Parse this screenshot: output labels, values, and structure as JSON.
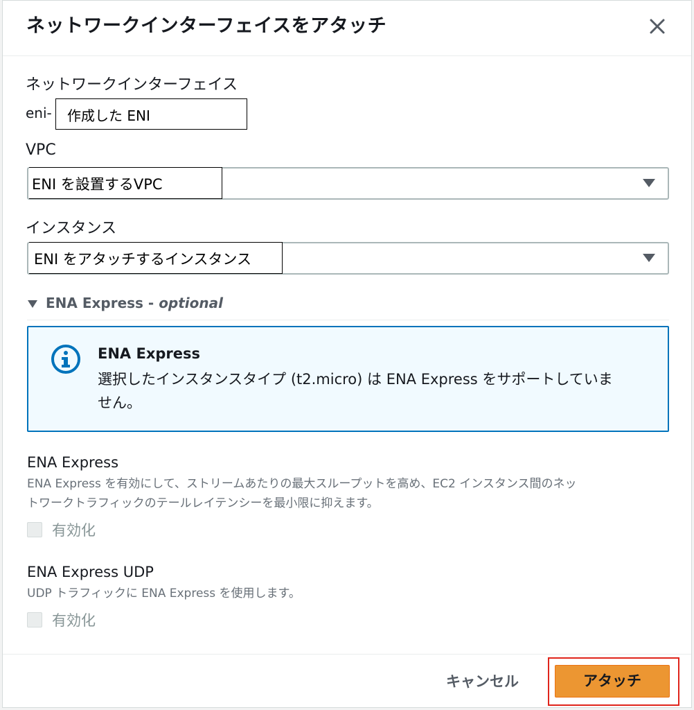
{
  "modal": {
    "title": "ネットワークインターフェイスをアタッチ"
  },
  "network_interface": {
    "label": "ネットワークインターフェイス",
    "prefix": "eni-",
    "value": "作成した ENI"
  },
  "vpc": {
    "label": "VPC",
    "value": "ENI を設置するVPC"
  },
  "instance": {
    "label": "インスタンス",
    "value": "ENI をアタッチするインスタンス"
  },
  "ena_section": {
    "expander_label": "ENA Express - ",
    "expander_optional": "optional"
  },
  "alert": {
    "title": "ENA Express",
    "line1": "選択したインスタンスタイプ (t2.micro) は ENA Express をサポートしていま",
    "line2": "せん。"
  },
  "ena_express": {
    "title": "ENA Express",
    "desc_line1": "ENA Express を有効にして、ストリームあたりの最大スループットを高め、EC2 インスタンス間のネッ",
    "desc_line2": "トワークトラフィックのテールレイテンシーを最小限に抑えます。",
    "checkbox_label": "有効化",
    "checked": false
  },
  "ena_express_udp": {
    "title": "ENA Express UDP",
    "desc": "UDP トラフィックに ENA Express を使用します。",
    "checkbox_label": "有効化",
    "checked": false
  },
  "footer": {
    "cancel_label": "キャンセル",
    "attach_label": "アタッチ"
  },
  "colors": {
    "primary_button": "#ec9632",
    "info_border": "#0073bb",
    "highlight_box": "#e0241b"
  }
}
